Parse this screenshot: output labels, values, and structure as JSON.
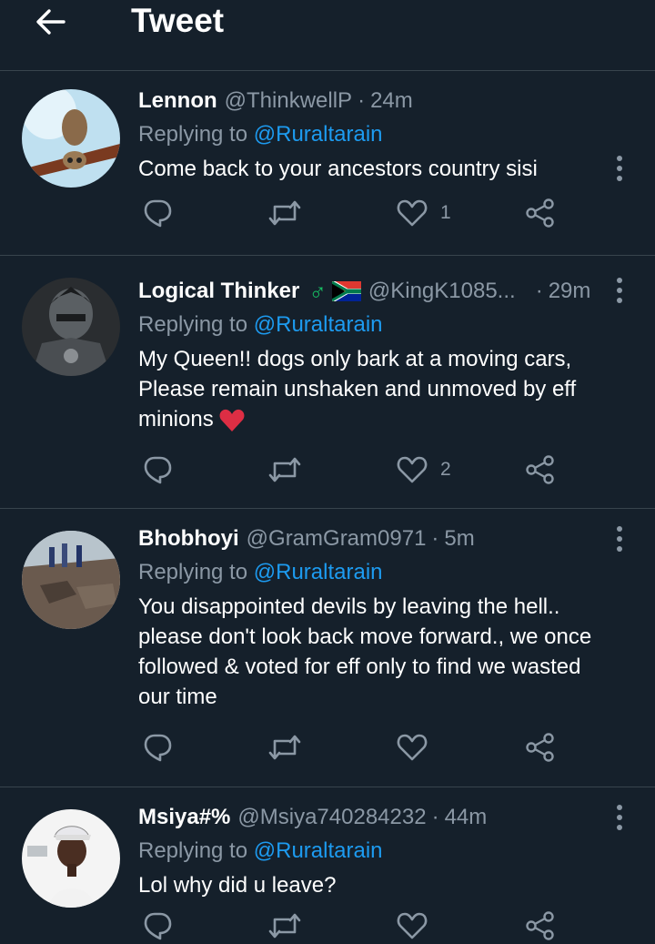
{
  "header": {
    "title": "Tweet"
  },
  "tweets": [
    {
      "name": "Lennon",
      "handle": "@ThinkwellP",
      "time": "24m",
      "replying_prefix": "Replying to ",
      "replying_to": "@Ruraltarain",
      "text": "Come back to your ancestors country sisi",
      "likes": "1"
    },
    {
      "name": "Logical Thinker",
      "name_suffix": "♂",
      "handle": "@KingK1085...",
      "time": "29m",
      "replying_prefix": "Replying to ",
      "replying_to": "@Ruraltarain",
      "text_lines": [
        "My Queen!! dogs only bark at a moving cars,",
        "Please remain unshaken and unmoved by eff",
        "minions"
      ],
      "likes": "2"
    },
    {
      "name": "Bhobhoyi",
      "handle": "@GramGram0971",
      "time": "5m",
      "replying_prefix": "Replying to ",
      "replying_to": "@Ruraltarain",
      "text_lines": [
        "You disappointed devils by leaving the hell..",
        "please don't look back move forward., we once",
        "followed & voted for eff only to find we wasted",
        "our time"
      ],
      "likes": ""
    },
    {
      "name": "Msiya#%",
      "handle": "@Msiya740284232",
      "time": "44m",
      "replying_prefix": "Replying to ",
      "replying_to": "@Ruraltarain",
      "text": "Lol why did u leave?",
      "likes": ""
    }
  ],
  "icons": {
    "back": "arrow-left-icon",
    "more": "more-vertical-icon",
    "reply": "reply-icon",
    "retweet": "retweet-icon",
    "like": "heart-icon",
    "share": "share-icon"
  },
  "colors": {
    "background": "#15202b",
    "mention": "#1d9bf0",
    "secondary": "#8b98a5",
    "divider": "#38444d"
  }
}
